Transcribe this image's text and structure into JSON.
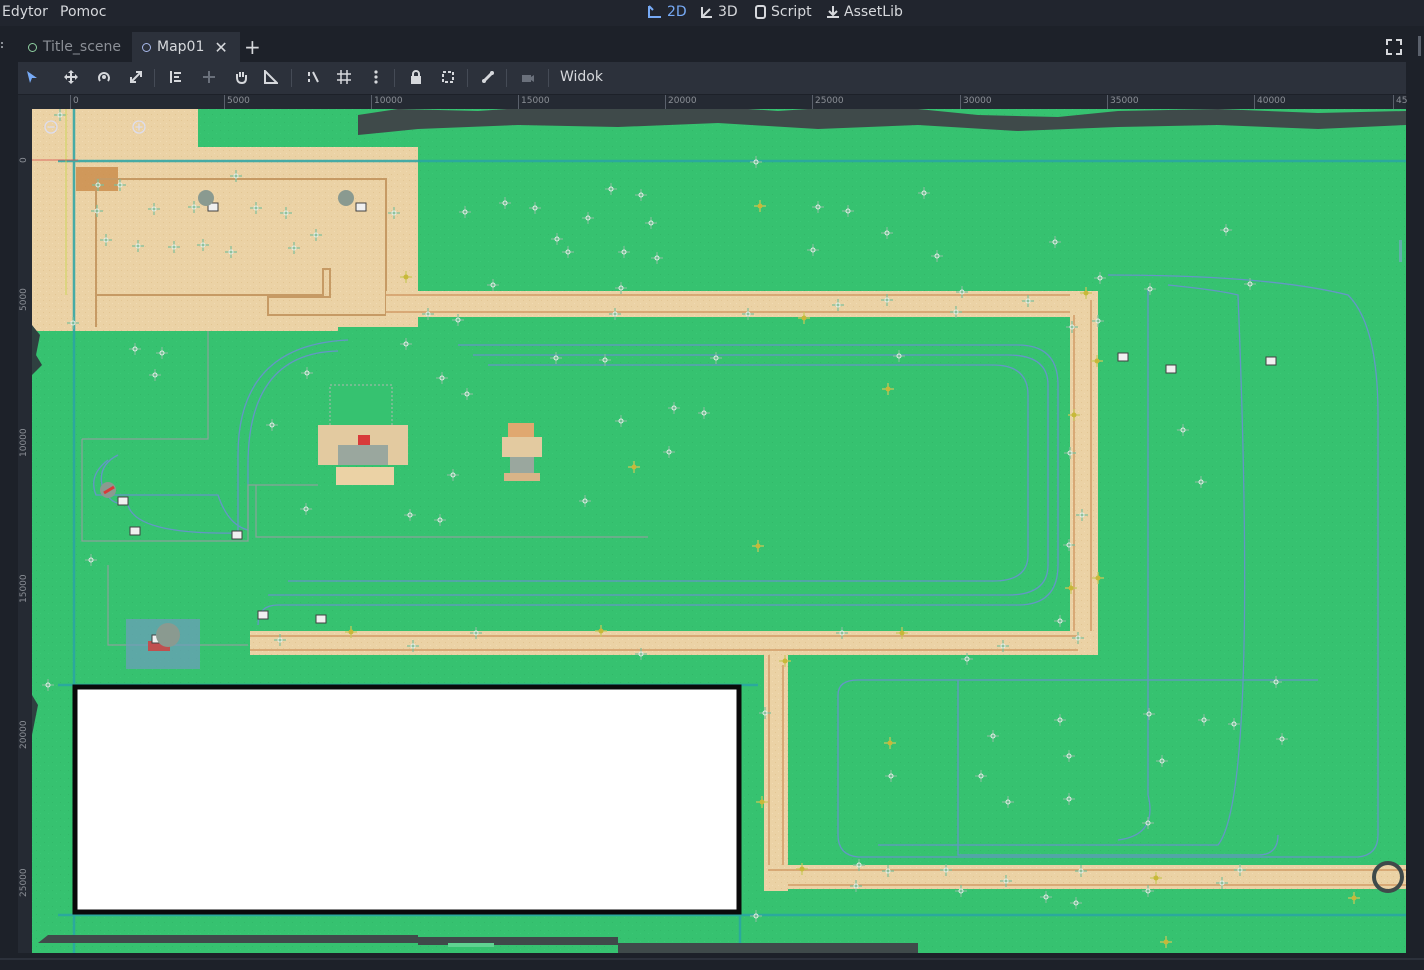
{
  "menubar": {
    "edit": "Edytor",
    "help": "Pomoc"
  },
  "workspaces": [
    {
      "label": "2D",
      "icon": "2d-icon",
      "active": true
    },
    {
      "label": "3D",
      "icon": "3d-icon",
      "active": false
    },
    {
      "label": "Script",
      "icon": "script-icon",
      "active": false
    },
    {
      "label": "AssetLib",
      "icon": "assetlib-icon",
      "active": false
    }
  ],
  "scene_tabs": [
    {
      "label": "Title_scene",
      "active": false
    },
    {
      "label": "Map01",
      "active": true
    }
  ],
  "toolbar": {
    "view_menu": "Widok"
  },
  "ruler": {
    "top_labels": [
      "0",
      "5000",
      "10000",
      "15000",
      "20000",
      "25000",
      "30000",
      "35000",
      "40000",
      "45"
    ],
    "left_labels": [
      "0",
      "5000",
      "10000",
      "15000",
      "20000",
      "25000"
    ]
  },
  "colors": {
    "grass": "#36c270",
    "sand": "#ebd2a5",
    "accent": "#77aaf5",
    "panel": "#2c313b"
  }
}
